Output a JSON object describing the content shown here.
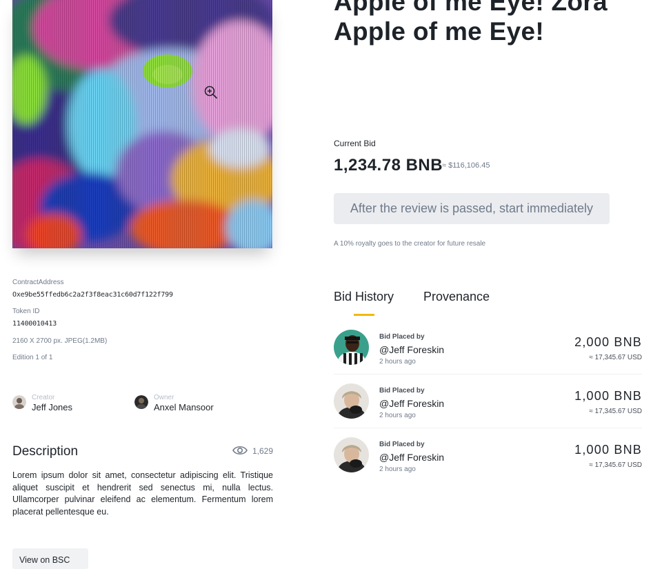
{
  "nft": {
    "title_line1": "Apple of me Eye! Zora",
    "title_line2": "Apple of me Eye!"
  },
  "meta": {
    "contract_label": "ContractAddress",
    "contract_value": "Oxe9be55ffedb6c2a2f3f8eac31c60d7f122f799",
    "token_label": "Token ID",
    "token_value": "11400010413",
    "dimensions": "2160 X 2700 px. JPEG(1.2MB)",
    "edition": "Edition 1 of 1"
  },
  "creator": {
    "role": "Creator",
    "name": "Jeff Jones"
  },
  "owner": {
    "role": "Owner",
    "name": "Anxel Mansoor"
  },
  "description": {
    "title": "Description",
    "views": "1,629",
    "text": "Lorem ipsum dolor sit amet, consectetur adipiscing elit. Tristique aliquet suscipit et hendrerit sed senectus mi, nulla lectus. Ullamcorper pulvinar eleifend ac elementum. Fermentum lorem placerat pellentesque eu."
  },
  "bsc_button": "View on BSC",
  "current_bid": {
    "label": "Current Bid",
    "amount": "1,234.78 BNB",
    "usd": "≈ $116,106.45"
  },
  "review_button": "After the review is passed, start immediately",
  "royalty_note": "A 10% royalty goes to the creator for future resale",
  "tabs": [
    {
      "label": "Bid History",
      "active": true
    },
    {
      "label": "Provenance",
      "active": false
    }
  ],
  "bids": [
    {
      "label": "Bid Placed by",
      "name": "@Jeff Foreskin",
      "time": "2 hours ago",
      "amount": "2,000 BNB",
      "usd": "≈ 17,345.67 USD"
    },
    {
      "label": "Bid Placed by",
      "name": "@Jeff Foreskin",
      "time": "2 hours ago",
      "amount": "1,000 BNB",
      "usd": "≈ 17,345.67 USD"
    },
    {
      "label": "Bid Placed by",
      "name": "@Jeff Foreskin",
      "time": "2 hours ago",
      "amount": "1,000 BNB",
      "usd": "≈ 17,345.67 USD"
    }
  ],
  "colors": {
    "accent": "#f0b90b",
    "text_primary": "#1e2329",
    "text_secondary": "#707a8a",
    "button_bg": "#eaecef"
  },
  "icons": {
    "zoom": "zoom-in-icon",
    "views": "eye-icon"
  }
}
